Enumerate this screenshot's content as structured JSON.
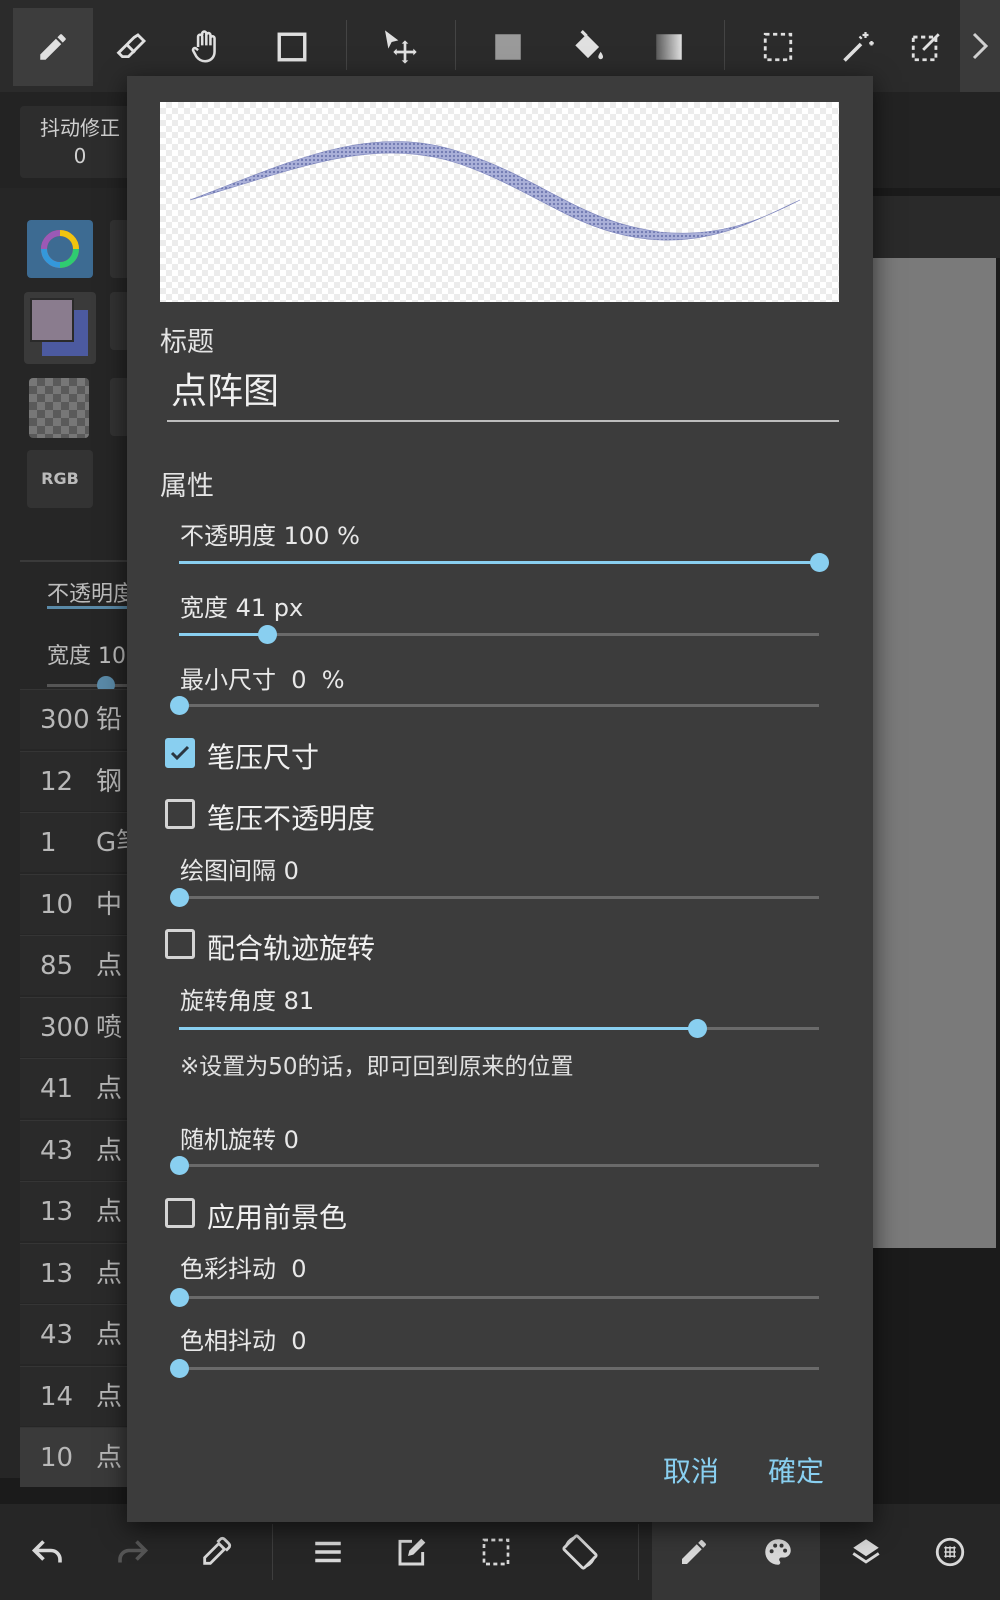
{
  "toolbar": {
    "tools": [
      "pen-icon",
      "eraser-icon",
      "hand-icon",
      "rectangle-icon",
      "move-icon",
      "fill-rect-icon",
      "bucket-icon",
      "gradient-icon",
      "select-rect-icon",
      "magic-wand-icon",
      "transform-icon"
    ],
    "more": "chevron-right-icon"
  },
  "background": {
    "jitter_label": "抖动修正",
    "jitter_value": "0",
    "rgb_label": "RGB",
    "opacity_label": "不透明度",
    "width_label": "宽度 10",
    "brush_list": [
      {
        "size": "300",
        "name": "铅"
      },
      {
        "size": "12",
        "name": "钢"
      },
      {
        "size": "1",
        "name": "G笔"
      },
      {
        "size": "10",
        "name": "中"
      },
      {
        "size": "85",
        "name": "点"
      },
      {
        "size": "300",
        "name": "喷"
      },
      {
        "size": "41",
        "name": "点"
      },
      {
        "size": "43",
        "name": "点"
      },
      {
        "size": "13",
        "name": "点"
      },
      {
        "size": "13",
        "name": "点"
      },
      {
        "size": "43",
        "name": "点"
      },
      {
        "size": "14",
        "name": "点"
      },
      {
        "size": "10",
        "name": "点"
      }
    ]
  },
  "dialog": {
    "title_section": "标题",
    "title_value": "点阵图",
    "props_section": "属性",
    "sliders": {
      "opacity": {
        "label": "不透明度 100 %",
        "fraction": 1.0
      },
      "width": {
        "label": "宽度 41 px",
        "fraction": 0.137
      },
      "min_size": {
        "label": "最小尺寸  0  %",
        "fraction": 0.0
      },
      "spacing": {
        "label": "绘图间隔 0",
        "fraction": 0.0
      },
      "rotation": {
        "label": "旋转角度 81",
        "fraction": 0.81
      },
      "random_rotation": {
        "label": "随机旋转 0",
        "fraction": 0.0
      },
      "color_jitter": {
        "label": "色彩抖动  0",
        "fraction": 0.0
      },
      "hue_jitter": {
        "label": "色相抖动  0",
        "fraction": 0.0
      }
    },
    "checkboxes": {
      "pressure_size": {
        "label": "笔压尺寸",
        "checked": true
      },
      "pressure_opacity": {
        "label": "笔压不透明度",
        "checked": false
      },
      "follow_path": {
        "label": "配合轨迹旋转",
        "checked": false
      },
      "foreground": {
        "label": "应用前景色",
        "checked": false
      }
    },
    "rotation_note": "※设置为50的话，即可回到原来的位置",
    "cancel": "取消",
    "ok": "確定"
  },
  "bottombar": {
    "tools": [
      "undo-icon",
      "redo-icon",
      "eyedropper-icon",
      "menu-icon",
      "edit-icon",
      "selection-icon",
      "rotate-screen-icon",
      "brush-icon",
      "palette-icon",
      "layers-icon",
      "material-icon"
    ]
  },
  "colors": {
    "accent": "#89cff0",
    "dialog_bg": "#3c3c3c",
    "stroke": "#8c93c8",
    "primary_swatch": "#8a7c8e",
    "secondary_swatch": "#4c5aa0"
  }
}
